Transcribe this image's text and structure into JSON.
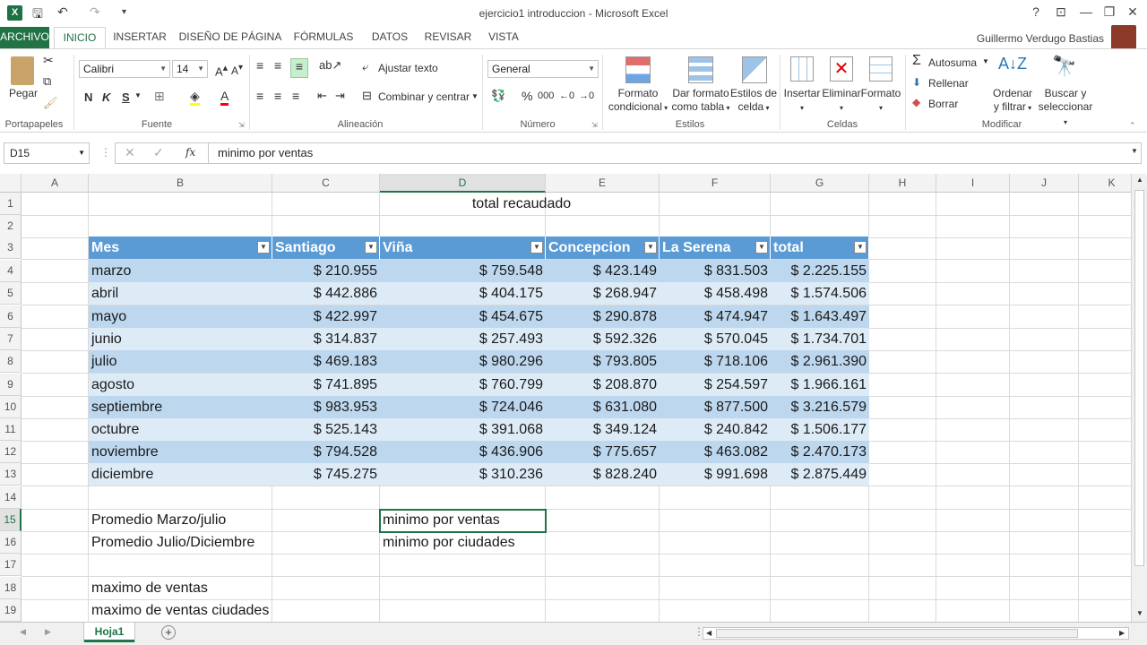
{
  "window": {
    "title": "ejercicio1 introduccion - Microsoft Excel",
    "user": "Guillermo Verdugo Bastias",
    "help": "?",
    "min": "—",
    "restore": "❐",
    "close": "✕"
  },
  "tabs": [
    "ARCHIVO",
    "INICIO",
    "INSERTAR",
    "DISEÑO DE PÁGINA",
    "FÓRMULAS",
    "DATOS",
    "REVISAR",
    "VISTA"
  ],
  "ribbon": {
    "portapapeles": {
      "paste": "Pegar",
      "label": "Portapapeles"
    },
    "fuente": {
      "font": "Calibri",
      "size": "14",
      "bold": "N",
      "italic": "K",
      "underline": "S",
      "label": "Fuente"
    },
    "alineacion": {
      "wrap": "Ajustar texto",
      "merge": "Combinar y centrar",
      "label": "Alineación"
    },
    "numero": {
      "format": "General",
      "percent": "%",
      "thousands": "000",
      "label": "Número"
    },
    "estilos": {
      "cond": "Formato",
      "cond2": "condicional",
      "table": "Dar formato",
      "table2": "como tabla",
      "cell": "Estilos de",
      "cell2": "celda",
      "label": "Estilos"
    },
    "celdas": {
      "insert": "Insertar",
      "delete": "Eliminar",
      "format": "Formato",
      "label": "Celdas"
    },
    "modificar": {
      "autosum": "Autosuma",
      "fill": "Rellenar",
      "clear": "Borrar",
      "sort": "Ordenar",
      "sort2": "y filtrar",
      "find": "Buscar y",
      "find2": "seleccionar",
      "label": "Modificar"
    }
  },
  "formula_bar": {
    "name_box": "D15",
    "fx": "fx",
    "value": "minimo por ventas"
  },
  "columns": [
    "A",
    "B",
    "C",
    "D",
    "E",
    "F",
    "G",
    "H",
    "I",
    "J",
    "K"
  ],
  "rows": [
    "1",
    "2",
    "3",
    "4",
    "5",
    "6",
    "7",
    "8",
    "9",
    "10",
    "11",
    "12",
    "13",
    "14",
    "15",
    "16",
    "17",
    "18",
    "19"
  ],
  "sheet": {
    "title": "total recaudado",
    "headers": [
      "Mes",
      "Santiago",
      "Viña",
      "Concepcion",
      "La Serena",
      "total"
    ],
    "data": [
      [
        "marzo",
        "$ 210.955",
        "$ 759.548",
        "$ 423.149",
        "$ 831.503",
        "$ 2.225.155"
      ],
      [
        "abril",
        "$ 442.886",
        "$ 404.175",
        "$ 268.947",
        "$ 458.498",
        "$ 1.574.506"
      ],
      [
        "mayo",
        "$ 422.997",
        "$ 454.675",
        "$ 290.878",
        "$ 474.947",
        "$ 1.643.497"
      ],
      [
        "junio",
        "$ 314.837",
        "$ 257.493",
        "$ 592.326",
        "$ 570.045",
        "$ 1.734.701"
      ],
      [
        "julio",
        "$ 469.183",
        "$ 980.296",
        "$ 793.805",
        "$ 718.106",
        "$ 2.961.390"
      ],
      [
        "agosto",
        "$ 741.895",
        "$ 760.799",
        "$ 208.870",
        "$ 254.597",
        "$ 1.966.161"
      ],
      [
        "septiembre",
        "$ 983.953",
        "$ 724.046",
        "$ 631.080",
        "$ 877.500",
        "$ 3.216.579"
      ],
      [
        "octubre",
        "$ 525.143",
        "$ 391.068",
        "$ 349.124",
        "$ 240.842",
        "$ 1.506.177"
      ],
      [
        "noviembre",
        "$ 794.528",
        "$ 436.906",
        "$ 775.657",
        "$ 463.082",
        "$ 2.470.173"
      ],
      [
        "diciembre",
        "$ 745.275",
        "$ 310.236",
        "$ 828.240",
        "$ 991.698",
        "$ 2.875.449"
      ]
    ],
    "b15": "Promedio Marzo/julio",
    "b16": "Promedio Julio/Diciembre",
    "b18": "maximo de ventas",
    "b19": "maximo de ventas ciudades",
    "d15": "minimo por ventas",
    "d16": "minimo por ciudades"
  },
  "sheet_tab": "Hoja1",
  "add_sheet": "+",
  "colors": {
    "accent": "#217346",
    "table_header": "#5b9bd5",
    "band_dark": "#bdd7ee",
    "band_light": "#ddebf7"
  }
}
